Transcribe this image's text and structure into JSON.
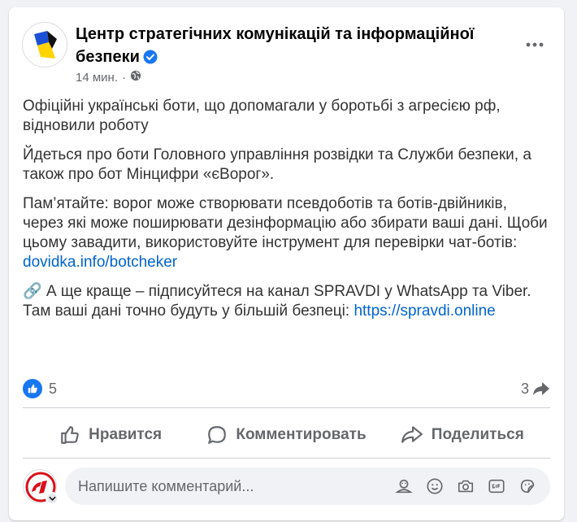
{
  "post": {
    "author": "Центр стратегічних комунікацій та інформаційної безпеки",
    "timestamp": "14 мин.",
    "separator": "·",
    "paragraphs": [
      {
        "text": "Офіційні українські боти, що допомагали у боротьбі з агресією рф, відновили роботу"
      },
      {
        "text": "Йдеться про боти Головного управління розвідки та Служби безпеки, а також про бот Мінцифри «єВорог»."
      },
      {
        "text": "Пам’ятайте: ворог може створювати псевдоботів та ботів-двійників, через які може поширювати дезінформацію або збирати ваші дані. Щоби цьому завадити, використовуйте інструмент для перевірки чат-ботів: ",
        "link": "dovidka.info/botcheker"
      },
      {
        "prefix_icon": "🔗",
        "text": " А ще краще – підписуйтеся на канал SPRAVDI у WhatsApp та Viber. Там ваші дані точно будуть у більшій безпеці: ",
        "link": "https://spravdi.online"
      }
    ]
  },
  "reactions": {
    "likes": "5",
    "shares": "3"
  },
  "actions": {
    "like": "Нравится",
    "comment": "Комментировать",
    "share": "Поделиться"
  },
  "comment_box": {
    "placeholder": "Напишите комментарий..."
  },
  "colors": {
    "accent": "#1877f2",
    "link": "#0064d1",
    "muted": "#65676b"
  }
}
